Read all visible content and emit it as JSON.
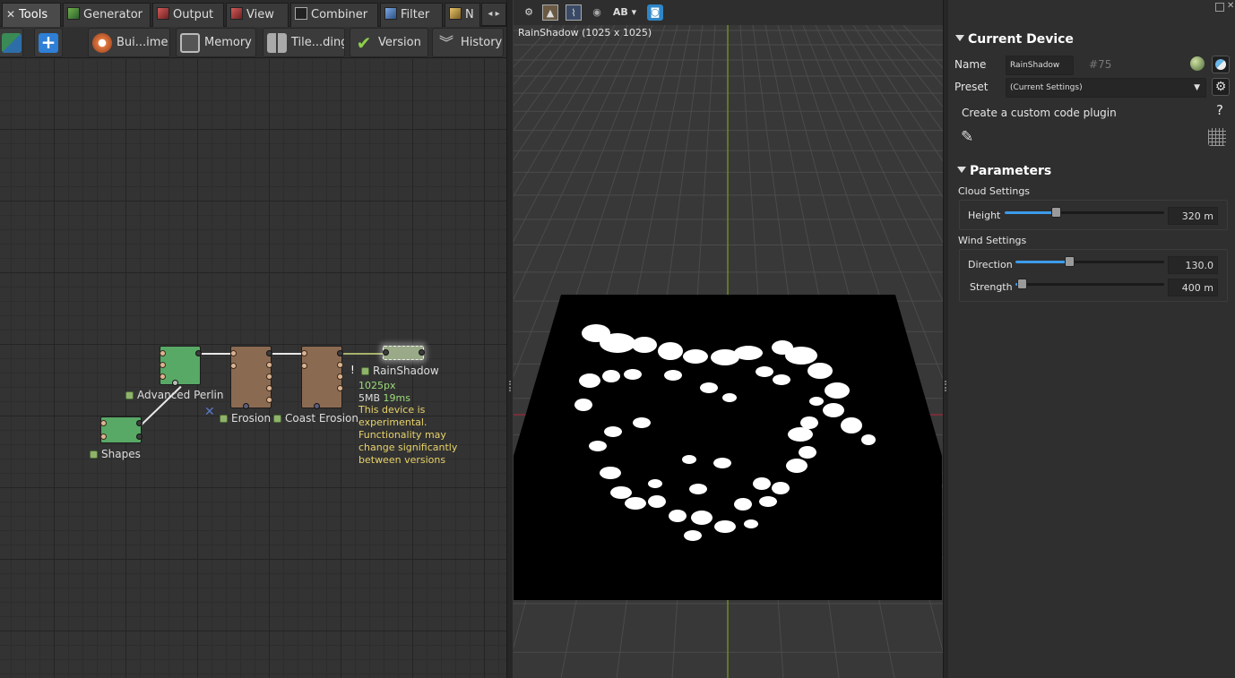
{
  "tabs": [
    {
      "label": "Tools",
      "icon": "wrench-icon",
      "active": true
    },
    {
      "label": "Generator",
      "icon": "generator-icon"
    },
    {
      "label": "Output",
      "icon": "output-icon"
    },
    {
      "label": "View",
      "icon": "view-icon"
    },
    {
      "label": "Combiner",
      "icon": "combiner-icon"
    },
    {
      "label": "Filter",
      "icon": "filter-icon"
    },
    {
      "label": "N",
      "icon": "natural-icon"
    }
  ],
  "toolbar": {
    "build_label": "Bui...ime",
    "memory_label": "Memory",
    "tile_label": "Tile...ding",
    "version_label": "Version",
    "history_label": "History"
  },
  "graph": {
    "nodes": {
      "advanced_perlin": "Advanced Perlin",
      "shapes": "Shapes",
      "erosion": "Erosion",
      "coast_erosion": "Coast Erosion",
      "rainshadow": "RainShadow"
    },
    "info": {
      "warn": "!",
      "resolution": "1025px",
      "memory": "5MB",
      "time": "19ms",
      "warning_lines": [
        "This device is",
        "experimental.",
        "Functionality may",
        "change significantly",
        "between versions"
      ]
    }
  },
  "viewport": {
    "title": "RainShadow (1025 x 1025)",
    "ab_label": "AB"
  },
  "properties": {
    "current_device_title": "Current Device",
    "name_label": "Name",
    "name_value": "RainShadow",
    "device_number": "#75",
    "preset_label": "Preset",
    "preset_value": "(Current Settings)",
    "custom_plugin_text": "Create a custom code plugin",
    "help_glyph": "?",
    "parameters_title": "Parameters",
    "cloud_settings_label": "Cloud Settings",
    "height_label": "Height",
    "height_value": "320 m",
    "height_fraction": 0.32,
    "wind_settings_label": "Wind Settings",
    "direction_label": "Direction",
    "direction_value": "130.0",
    "direction_fraction": 0.36,
    "strength_label": "Strength",
    "strength_value": "400 m",
    "strength_fraction": 0.04
  },
  "colors": {
    "accent": "#3d9be9",
    "node_generator": "#58a866",
    "node_erosion": "#8b6a52",
    "node_selected": "#9aaa88",
    "info_green": "#9ddc7a",
    "info_yellow": "#e8d36a"
  }
}
